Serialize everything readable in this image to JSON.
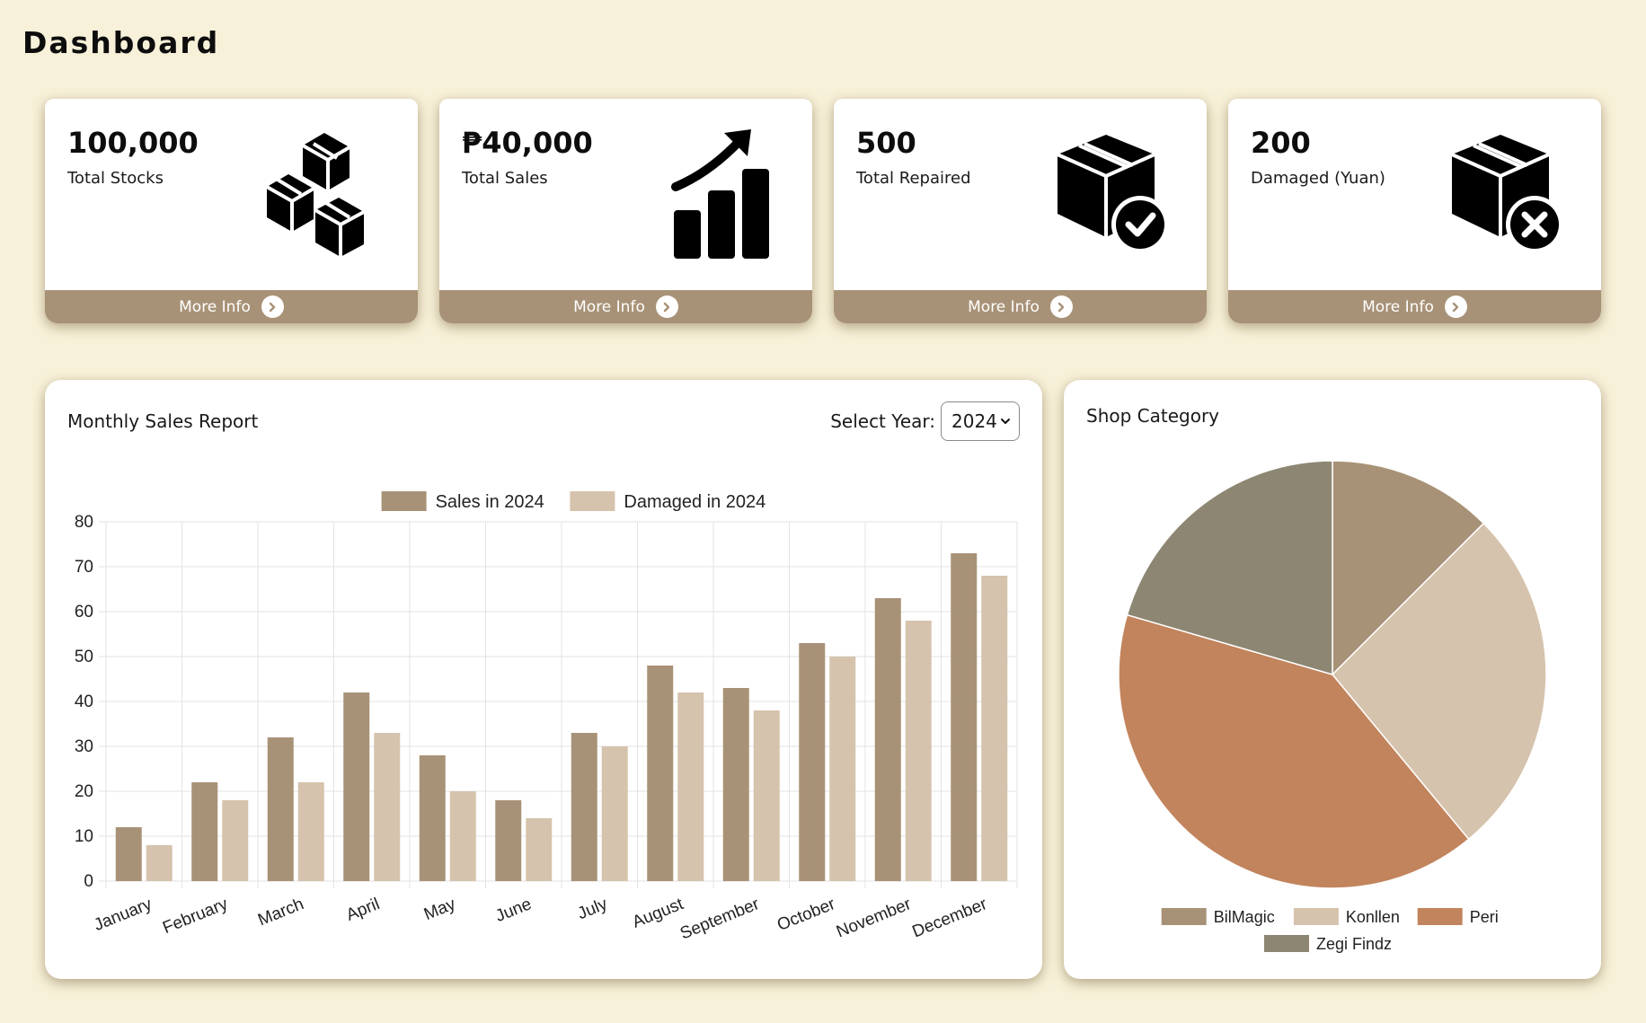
{
  "page": {
    "title": "Dashboard"
  },
  "colors": {
    "background": "#f8f1d9",
    "card_footer": "#a89277",
    "sales_bar": "#a89277",
    "damaged_bar": "#d6c3ad"
  },
  "cards": [
    {
      "value": "100,000",
      "label": "Total Stocks",
      "icon": "boxes-icon",
      "more": "More Info"
    },
    {
      "value": "₱40,000",
      "label": "Total Sales",
      "icon": "growth-chart-icon",
      "more": "More Info"
    },
    {
      "value": "500",
      "label": "Total Repaired",
      "icon": "box-check-icon",
      "more": "More Info"
    },
    {
      "value": "200",
      "label": "Damaged (Yuan)",
      "icon": "box-x-icon",
      "more": "More Info"
    }
  ],
  "sales_report": {
    "title": "Monthly Sales Report",
    "select_label": "Select Year:",
    "selected_year": "2024"
  },
  "shop_category": {
    "title": "Shop Category"
  },
  "chart_data": [
    {
      "type": "bar",
      "title": "Monthly Sales Report",
      "categories": [
        "January",
        "February",
        "March",
        "April",
        "May",
        "June",
        "July",
        "August",
        "September",
        "October",
        "November",
        "December"
      ],
      "series": [
        {
          "name": "Sales in 2024",
          "color": "#a89277",
          "values": [
            12,
            22,
            32,
            42,
            28,
            18,
            33,
            48,
            43,
            53,
            63,
            73
          ]
        },
        {
          "name": "Damaged in 2024",
          "color": "#d6c3ad",
          "values": [
            8,
            18,
            22,
            33,
            20,
            14,
            30,
            42,
            38,
            50,
            58,
            68
          ]
        }
      ],
      "ylim": [
        0,
        80
      ],
      "yticks": [
        0,
        10,
        20,
        30,
        40,
        50,
        60,
        70,
        80
      ],
      "grid": true,
      "legend": "top"
    },
    {
      "type": "pie",
      "title": "Shop Category",
      "labels": [
        "BilMagic",
        "Konllen",
        "Peri",
        "Zegi Findz"
      ],
      "values": [
        12.5,
        26.5,
        40.5,
        20.5
      ],
      "colors": [
        "#a89277",
        "#d6c3ad",
        "#c2845d",
        "#8d8672"
      ],
      "legend": "bottom"
    }
  ]
}
